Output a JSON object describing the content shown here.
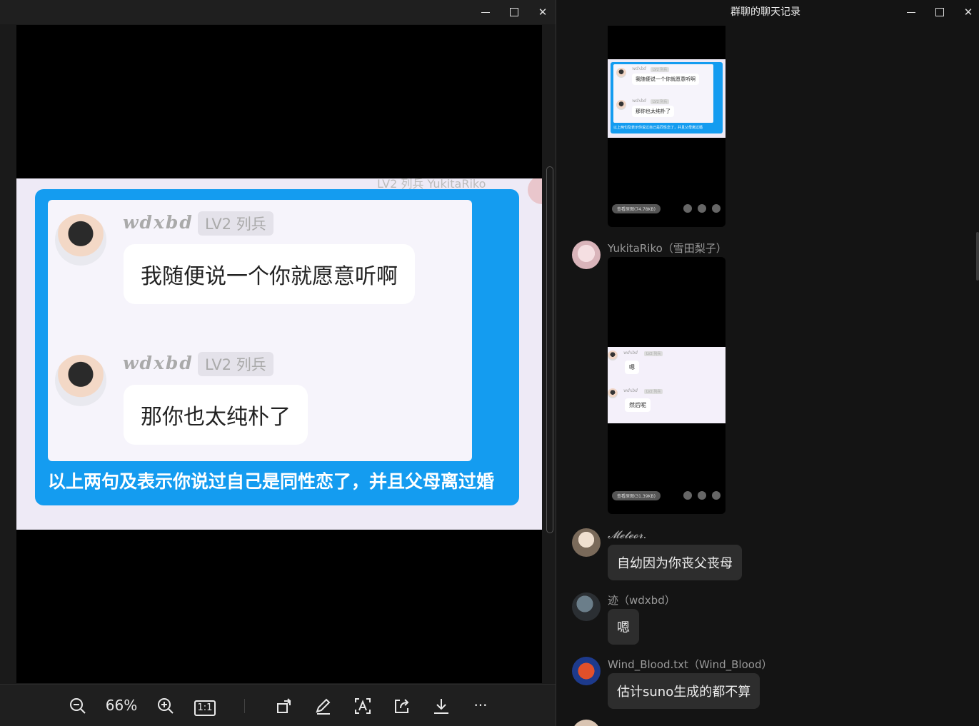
{
  "viewer": {
    "window_controls": {
      "minimize": "—",
      "maximize": "☐",
      "close": "✕"
    },
    "image": {
      "header_fragment": "LV2 列兵  YukitaRiko",
      "messages": [
        {
          "user": "wdxbd",
          "badge": "LV2 列兵",
          "text": "我随便说一个你就愿意听啊"
        },
        {
          "user": "wdxbd",
          "badge": "LV2 列兵",
          "text": "那你也太纯朴了"
        }
      ],
      "caption": "以上两句及表示你说过自己是同性恋了，并且父母离过婚"
    },
    "toolbar": {
      "zoom": "66%",
      "actual_size": "1:1",
      "more": "···",
      "icons": [
        "zoom-out-icon",
        "zoom-in-icon",
        "actual-size-icon",
        "rotate-icon",
        "edit-icon",
        "ocr-icon",
        "share-icon",
        "download-icon",
        "more-icon"
      ]
    }
  },
  "chat": {
    "title": "群聊的聊天记录",
    "window_controls": {
      "minimize": "—",
      "maximize": "☐",
      "close": "✕"
    },
    "thumb1": {
      "messages": [
        {
          "user": "wdxbd",
          "badge": "LV2 列兵",
          "text": "我随便说一个你就愿意听啊"
        },
        {
          "user": "wdxbd",
          "badge": "LV2 列兵",
          "text": "那你也太纯朴了"
        }
      ],
      "caption": "以上两句及表示你说过自己是同性恋了，并且父母离过婚",
      "pill": "查看原图(74.78KB)"
    },
    "messages": [
      {
        "name": "YukitaRiko（雪田梨子）",
        "type": "image",
        "thumb": {
          "messages": [
            {
              "user": "wdxbd",
              "badge": "LV2 列兵",
              "text": "嗯"
            },
            {
              "user": "wdxbd",
              "badge": "LV2 列兵",
              "text": "然后呢"
            }
          ],
          "pill": "查看原图(31.39KB)"
        }
      },
      {
        "name": "𝓜𝓮𝓽𝓮𝓸𝓻.",
        "type": "text",
        "text": "自幼因为你丧父丧母"
      },
      {
        "name": "迹（wdxbd）",
        "type": "text",
        "text": "嗯"
      },
      {
        "name": "Wind_Blood.txt（Wind_Blood）",
        "type": "text",
        "text": "估计suno生成的都不算"
      }
    ],
    "colors": {
      "bubble": "#2d2d2d",
      "background": "#141414",
      "accent": "#149cf0"
    }
  }
}
